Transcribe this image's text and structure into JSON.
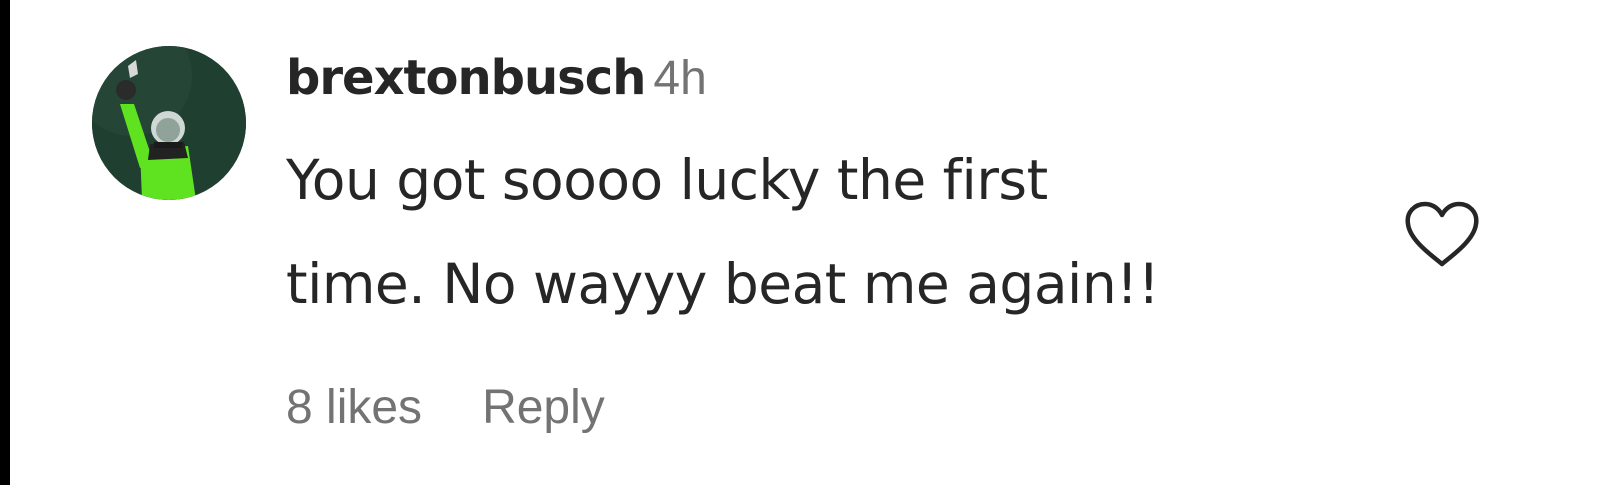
{
  "comment": {
    "username": "brextonbusch",
    "time": "4h",
    "text_lines": [
      "You got soooo lucky the first",
      "time. No wayyy beat me again!!"
    ],
    "likes": "8 likes",
    "reply": "Reply",
    "avatar_icon": "user-avatar",
    "like_icon": "heart-outline-icon"
  },
  "colors": {
    "primary_text": "#262626",
    "secondary_text": "#737373",
    "avatar_bg": "#1b3a2c",
    "avatar_figure": "#5fe21f"
  }
}
